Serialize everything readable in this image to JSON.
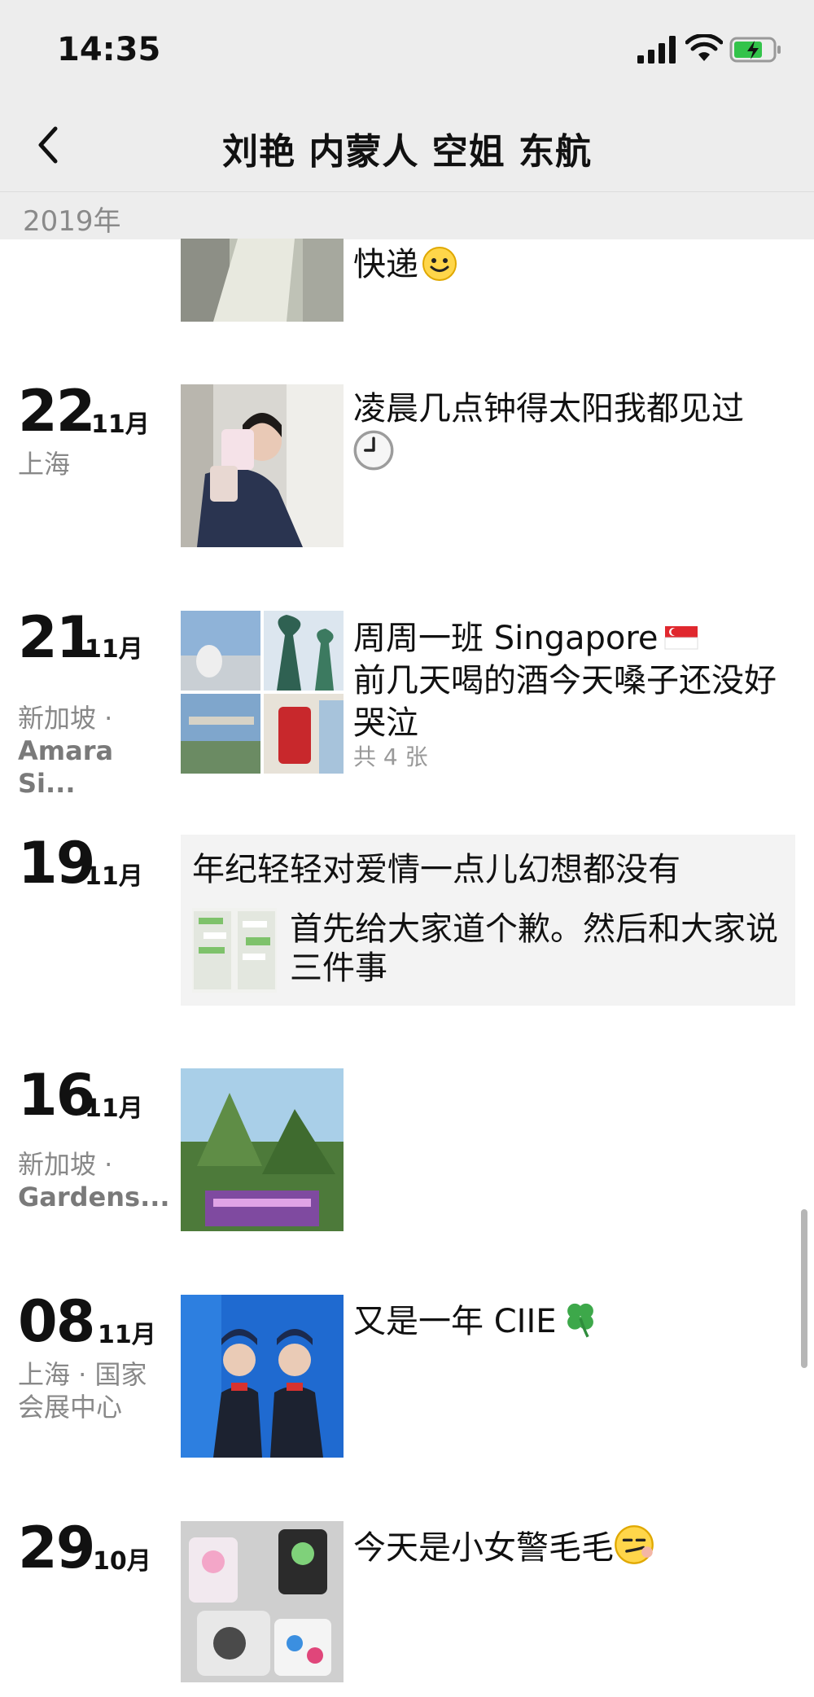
{
  "status": {
    "time": "14:35"
  },
  "nav": {
    "title": "刘艳 内蒙人 空姐 东航"
  },
  "year_label": "2019年",
  "top_partial": {
    "caption": "快递"
  },
  "posts": [
    {
      "day": "22",
      "month": "11月",
      "location": "上海",
      "caption": "凌晨几点钟得太阳我都见过"
    },
    {
      "day": "21",
      "month": "11月",
      "location_line1": "新加坡 ·",
      "location_line2": "Amara Si...",
      "caption_line1": "周周一班 Singapore",
      "caption_line2": "前几天喝的酒今天嗓子还没好 哭泣",
      "photo_count": "共 4 张"
    },
    {
      "day": "19",
      "month": "11月",
      "shared_text": "年纪轻轻对爱情一点儿幻想都没有",
      "shared_title": "首先给大家道个歉。然后和大家说三件事"
    },
    {
      "day": "16",
      "month": "11月",
      "location_line1": "新加坡 ·",
      "location_line2": "Gardens..."
    },
    {
      "day": "08",
      "month": "11月",
      "location_line1": "上海 · 国家",
      "location_line2": "会展中心",
      "caption": "又是一年 CIIE"
    },
    {
      "day": "29",
      "month": "10月",
      "caption": "今天是小女警毛毛"
    }
  ],
  "colors": {
    "nav_bg": "#ededed",
    "muted_text": "#888888",
    "shared_card_bg": "#f3f3f3"
  },
  "icons": [
    "signal-icon",
    "wifi-icon",
    "battery-charging-icon",
    "back-chevron-icon",
    "smile-emoji-icon",
    "clock-emoji-icon",
    "singapore-flag-icon",
    "clover-emoji-icon",
    "smirk-emoji-icon"
  ]
}
